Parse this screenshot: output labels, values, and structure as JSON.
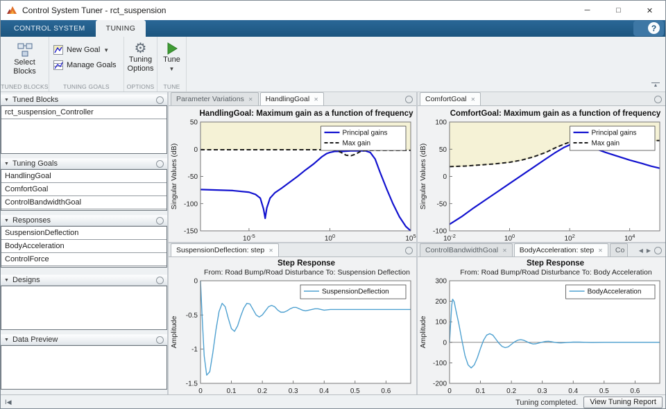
{
  "window": {
    "title": "Control System Tuner - rct_suspension",
    "minimize": "─",
    "maximize": "□",
    "close": "✕"
  },
  "ribbon": {
    "tabs": [
      {
        "label": "CONTROL SYSTEM"
      },
      {
        "label": "TUNING"
      }
    ],
    "help_label": "?"
  },
  "toolbar": {
    "select_blocks": "Select Blocks",
    "new_goal": "New Goal",
    "manage_goals": "Manage Goals",
    "tuning_options": "Tuning Options",
    "tune": "Tune",
    "sections": {
      "tuned_blocks": "TUNED BLOCKS",
      "tuning_goals": "TUNING GOALS",
      "options": "OPTIONS",
      "tune": "TUNE"
    }
  },
  "sidebar": {
    "panels": [
      {
        "title": "Tuned Blocks",
        "items": [
          "rct_suspension_Controller"
        ]
      },
      {
        "title": "Tuning Goals",
        "items": [
          "HandlingGoal",
          "ComfortGoal",
          "ControlBandwidthGoal"
        ]
      },
      {
        "title": "Responses",
        "items": [
          "SuspensionDeflection",
          "BodyAcceleration",
          "ControlForce"
        ]
      },
      {
        "title": "Designs",
        "items": []
      },
      {
        "title": "Data Preview",
        "items": []
      }
    ]
  },
  "doc_tabs": {
    "q0": [
      {
        "label": "Parameter Variations"
      },
      {
        "label": "HandlingGoal"
      }
    ],
    "q1": [
      {
        "label": "ComfortGoal"
      }
    ],
    "q2": [
      {
        "label": "SuspensionDeflection: step"
      }
    ],
    "q3": [
      {
        "label": "ControlBandwidthGoal"
      },
      {
        "label": "BodyAcceleration: step"
      },
      {
        "label": "Co"
      }
    ]
  },
  "statusbar": {
    "message": "Tuning completed.",
    "report_button": "View Tuning Report"
  },
  "colors": {
    "ribbon_blue": "#1c557f",
    "goal_line": "#1212cf",
    "max_gain_line": "#1a1a1a",
    "step_line": "#4da0d0",
    "region_fill": "#f5f2d6",
    "region_edge": "#d9d3a2",
    "axes_bg": "#ffffff",
    "figure_bg": "#f1f2f3"
  },
  "chart_data": [
    {
      "type": "line",
      "title": "HandlingGoal: Maximum gain as a function of frequency",
      "ylabel": "Singular Values (dB)",
      "xscale": "log10",
      "xlim": [
        -8,
        5
      ],
      "ylim": [
        -150,
        50
      ],
      "xticks": [
        -5,
        0,
        5
      ],
      "yticks": [
        -150,
        -100,
        -50,
        0,
        50
      ],
      "legend": true,
      "region": [
        [
          -8,
          0
        ],
        [
          5,
          0
        ],
        [
          5,
          50
        ],
        [
          -8,
          50
        ]
      ],
      "series": [
        {
          "name": "Principal gains",
          "color": "#1212cf",
          "width": 2.2,
          "dash": false,
          "points": [
            [
              -8,
              -74
            ],
            [
              -7,
              -75
            ],
            [
              -6,
              -76
            ],
            [
              -5,
              -79
            ],
            [
              -4.6,
              -83
            ],
            [
              -4.3,
              -90
            ],
            [
              -4.1,
              -110
            ],
            [
              -4,
              -127
            ],
            [
              -3.9,
              -108
            ],
            [
              -3.7,
              -90
            ],
            [
              -3.4,
              -80
            ],
            [
              -3,
              -72
            ],
            [
              -2.5,
              -61
            ],
            [
              -2,
              -50
            ],
            [
              -1.5,
              -38
            ],
            [
              -1,
              -27
            ],
            [
              -0.5,
              -14
            ],
            [
              -0.2,
              -8
            ],
            [
              0,
              -6
            ],
            [
              0.3,
              -4
            ],
            [
              0.8,
              -4
            ],
            [
              1.3,
              -3
            ],
            [
              1.8,
              -3
            ],
            [
              2.2,
              -3
            ],
            [
              2.5,
              -6
            ],
            [
              2.8,
              -18
            ],
            [
              3.1,
              -42
            ],
            [
              3.5,
              -72
            ],
            [
              3.9,
              -100
            ],
            [
              4.3,
              -124
            ],
            [
              4.7,
              -142
            ],
            [
              5,
              -150
            ]
          ]
        },
        {
          "name": "Max gain",
          "color": "#1a1a1a",
          "width": 2,
          "dash": true,
          "points": [
            [
              -8,
              -1
            ],
            [
              -1,
              -1
            ],
            [
              -0.5,
              -1
            ],
            [
              0,
              -1
            ],
            [
              0.4,
              -2
            ],
            [
              0.7,
              -6
            ],
            [
              1,
              -11
            ],
            [
              1.3,
              -12
            ],
            [
              1.6,
              -9
            ],
            [
              1.9,
              -4
            ],
            [
              2.2,
              -2
            ],
            [
              2.6,
              -2
            ],
            [
              5,
              -2
            ]
          ]
        }
      ]
    },
    {
      "type": "line",
      "title": "ComfortGoal: Maximum gain as a function of frequency",
      "ylabel": "Singular Values (dB)",
      "xscale": "log10",
      "xlim": [
        -2,
        5
      ],
      "ylim": [
        -100,
        100
      ],
      "xticks": [
        -2,
        0,
        2,
        4
      ],
      "yticks": [
        -100,
        -50,
        0,
        50,
        100
      ],
      "legend": true,
      "region": [
        [
          -2,
          18
        ],
        [
          -1.5,
          19
        ],
        [
          -1,
          21
        ],
        [
          -0.5,
          23
        ],
        [
          0,
          26
        ],
        [
          0.4,
          30
        ],
        [
          0.8,
          36
        ],
        [
          1.2,
          44
        ],
        [
          1.5,
          52
        ],
        [
          1.8,
          59
        ],
        [
          2,
          63
        ],
        [
          2.2,
          65
        ],
        [
          2.5,
          66
        ],
        [
          5,
          66
        ],
        [
          5,
          100
        ],
        [
          -2,
          100
        ]
      ],
      "series": [
        {
          "name": "Principal gains",
          "color": "#1212cf",
          "width": 2.2,
          "dash": false,
          "points": [
            [
              -2,
              -88
            ],
            [
              -1.6,
              -74
            ],
            [
              -1.2,
              -58
            ],
            [
              -0.8,
              -43
            ],
            [
              -0.4,
              -28
            ],
            [
              0,
              -13
            ],
            [
              0.4,
              2
            ],
            [
              0.8,
              17
            ],
            [
              1.2,
              32
            ],
            [
              1.5,
              43
            ],
            [
              1.8,
              53
            ],
            [
              2,
              58
            ],
            [
              2.2,
              61
            ],
            [
              2.4,
              60
            ],
            [
              2.6,
              56
            ],
            [
              2.9,
              50
            ],
            [
              3.2,
              44
            ],
            [
              3.6,
              37
            ],
            [
              4,
              30
            ],
            [
              4.4,
              24
            ],
            [
              4.7,
              19
            ],
            [
              5,
              15
            ]
          ]
        },
        {
          "name": "Max gain",
          "color": "#1a1a1a",
          "width": 2,
          "dash": true,
          "points": [
            [
              -2,
              18
            ],
            [
              -1.5,
              19
            ],
            [
              -1,
              21
            ],
            [
              -0.5,
              23
            ],
            [
              0,
              26
            ],
            [
              0.4,
              30
            ],
            [
              0.8,
              36
            ],
            [
              1.2,
              44
            ],
            [
              1.5,
              52
            ],
            [
              1.8,
              59
            ],
            [
              2,
              63
            ],
            [
              2.2,
              65
            ],
            [
              2.5,
              66
            ],
            [
              5,
              66
            ]
          ]
        }
      ]
    },
    {
      "type": "line",
      "title": "Step Response",
      "subtitle": "From: Road Bump/Road Disturbance  To: Suspension Deflection",
      "ylabel": "Amplitude",
      "xscale": "linear",
      "xlim": [
        0,
        0.68
      ],
      "ylim": [
        -1.5,
        0
      ],
      "xticks": [
        0,
        0.1,
        0.2,
        0.3,
        0.4,
        0.5,
        0.6
      ],
      "yticks": [
        -1.5,
        -1,
        -0.5,
        0
      ],
      "legend": true,
      "series": [
        {
          "name": "SuspensionDeflection",
          "color": "#4da0d0",
          "width": 1.4,
          "dash": false,
          "points": [
            [
              0,
              0
            ],
            [
              0.005,
              -0.5
            ],
            [
              0.012,
              -1.1
            ],
            [
              0.02,
              -1.38
            ],
            [
              0.03,
              -1.33
            ],
            [
              0.04,
              -1.05
            ],
            [
              0.05,
              -0.72
            ],
            [
              0.06,
              -0.45
            ],
            [
              0.07,
              -0.33
            ],
            [
              0.08,
              -0.38
            ],
            [
              0.09,
              -0.55
            ],
            [
              0.1,
              -0.7
            ],
            [
              0.11,
              -0.74
            ],
            [
              0.12,
              -0.66
            ],
            [
              0.13,
              -0.52
            ],
            [
              0.14,
              -0.4
            ],
            [
              0.15,
              -0.33
            ],
            [
              0.16,
              -0.34
            ],
            [
              0.17,
              -0.42
            ],
            [
              0.18,
              -0.5
            ],
            [
              0.19,
              -0.53
            ],
            [
              0.2,
              -0.5
            ],
            [
              0.21,
              -0.44
            ],
            [
              0.22,
              -0.38
            ],
            [
              0.23,
              -0.36
            ],
            [
              0.24,
              -0.38
            ],
            [
              0.25,
              -0.43
            ],
            [
              0.26,
              -0.46
            ],
            [
              0.27,
              -0.46
            ],
            [
              0.28,
              -0.44
            ],
            [
              0.29,
              -0.41
            ],
            [
              0.3,
              -0.39
            ],
            [
              0.31,
              -0.39
            ],
            [
              0.32,
              -0.41
            ],
            [
              0.33,
              -0.43
            ],
            [
              0.34,
              -0.44
            ],
            [
              0.35,
              -0.43
            ],
            [
              0.36,
              -0.42
            ],
            [
              0.37,
              -0.41
            ],
            [
              0.38,
              -0.41
            ],
            [
              0.39,
              -0.42
            ],
            [
              0.4,
              -0.43
            ],
            [
              0.42,
              -0.42
            ],
            [
              0.44,
              -0.42
            ],
            [
              0.46,
              -0.42
            ],
            [
              0.5,
              -0.42
            ],
            [
              0.55,
              -0.42
            ],
            [
              0.6,
              -0.42
            ],
            [
              0.65,
              -0.42
            ],
            [
              0.68,
              -0.42
            ]
          ]
        }
      ]
    },
    {
      "type": "line",
      "title": "Step Response",
      "subtitle": "From: Road Bump/Road Disturbance  To: Body Acceleration",
      "ylabel": "Amplitude",
      "xscale": "linear",
      "xlim": [
        0,
        0.68
      ],
      "ylim": [
        -200,
        300
      ],
      "xticks": [
        0,
        0.1,
        0.2,
        0.3,
        0.4,
        0.5,
        0.6
      ],
      "yticks": [
        -200,
        -100,
        0,
        100,
        200,
        300
      ],
      "zeroline": true,
      "legend": true,
      "series": [
        {
          "name": "BodyAcceleration",
          "color": "#4da0d0",
          "width": 1.4,
          "dash": false,
          "points": [
            [
              0,
              0
            ],
            [
              0.003,
              80
            ],
            [
              0.007,
              180
            ],
            [
              0.01,
              210
            ],
            [
              0.015,
              198
            ],
            [
              0.02,
              160
            ],
            [
              0.03,
              90
            ],
            [
              0.04,
              10
            ],
            [
              0.05,
              -65
            ],
            [
              0.06,
              -110
            ],
            [
              0.07,
              -125
            ],
            [
              0.08,
              -110
            ],
            [
              0.09,
              -75
            ],
            [
              0.1,
              -30
            ],
            [
              0.11,
              10
            ],
            [
              0.12,
              35
            ],
            [
              0.13,
              42
            ],
            [
              0.14,
              35
            ],
            [
              0.15,
              15
            ],
            [
              0.16,
              -5
            ],
            [
              0.17,
              -20
            ],
            [
              0.18,
              -26
            ],
            [
              0.19,
              -22
            ],
            [
              0.2,
              -10
            ],
            [
              0.21,
              2
            ],
            [
              0.22,
              10
            ],
            [
              0.23,
              13
            ],
            [
              0.24,
              10
            ],
            [
              0.25,
              3
            ],
            [
              0.26,
              -4
            ],
            [
              0.27,
              -8
            ],
            [
              0.28,
              -7
            ],
            [
              0.29,
              -3
            ],
            [
              0.3,
              1
            ],
            [
              0.31,
              4
            ],
            [
              0.32,
              5
            ],
            [
              0.33,
              3
            ],
            [
              0.34,
              0
            ],
            [
              0.35,
              -2
            ],
            [
              0.36,
              -3
            ],
            [
              0.38,
              -1
            ],
            [
              0.4,
              1
            ],
            [
              0.42,
              1
            ],
            [
              0.44,
              0
            ],
            [
              0.46,
              -1
            ],
            [
              0.5,
              0
            ],
            [
              0.55,
              0
            ],
            [
              0.6,
              0
            ],
            [
              0.65,
              0
            ],
            [
              0.68,
              0
            ]
          ]
        }
      ]
    }
  ]
}
